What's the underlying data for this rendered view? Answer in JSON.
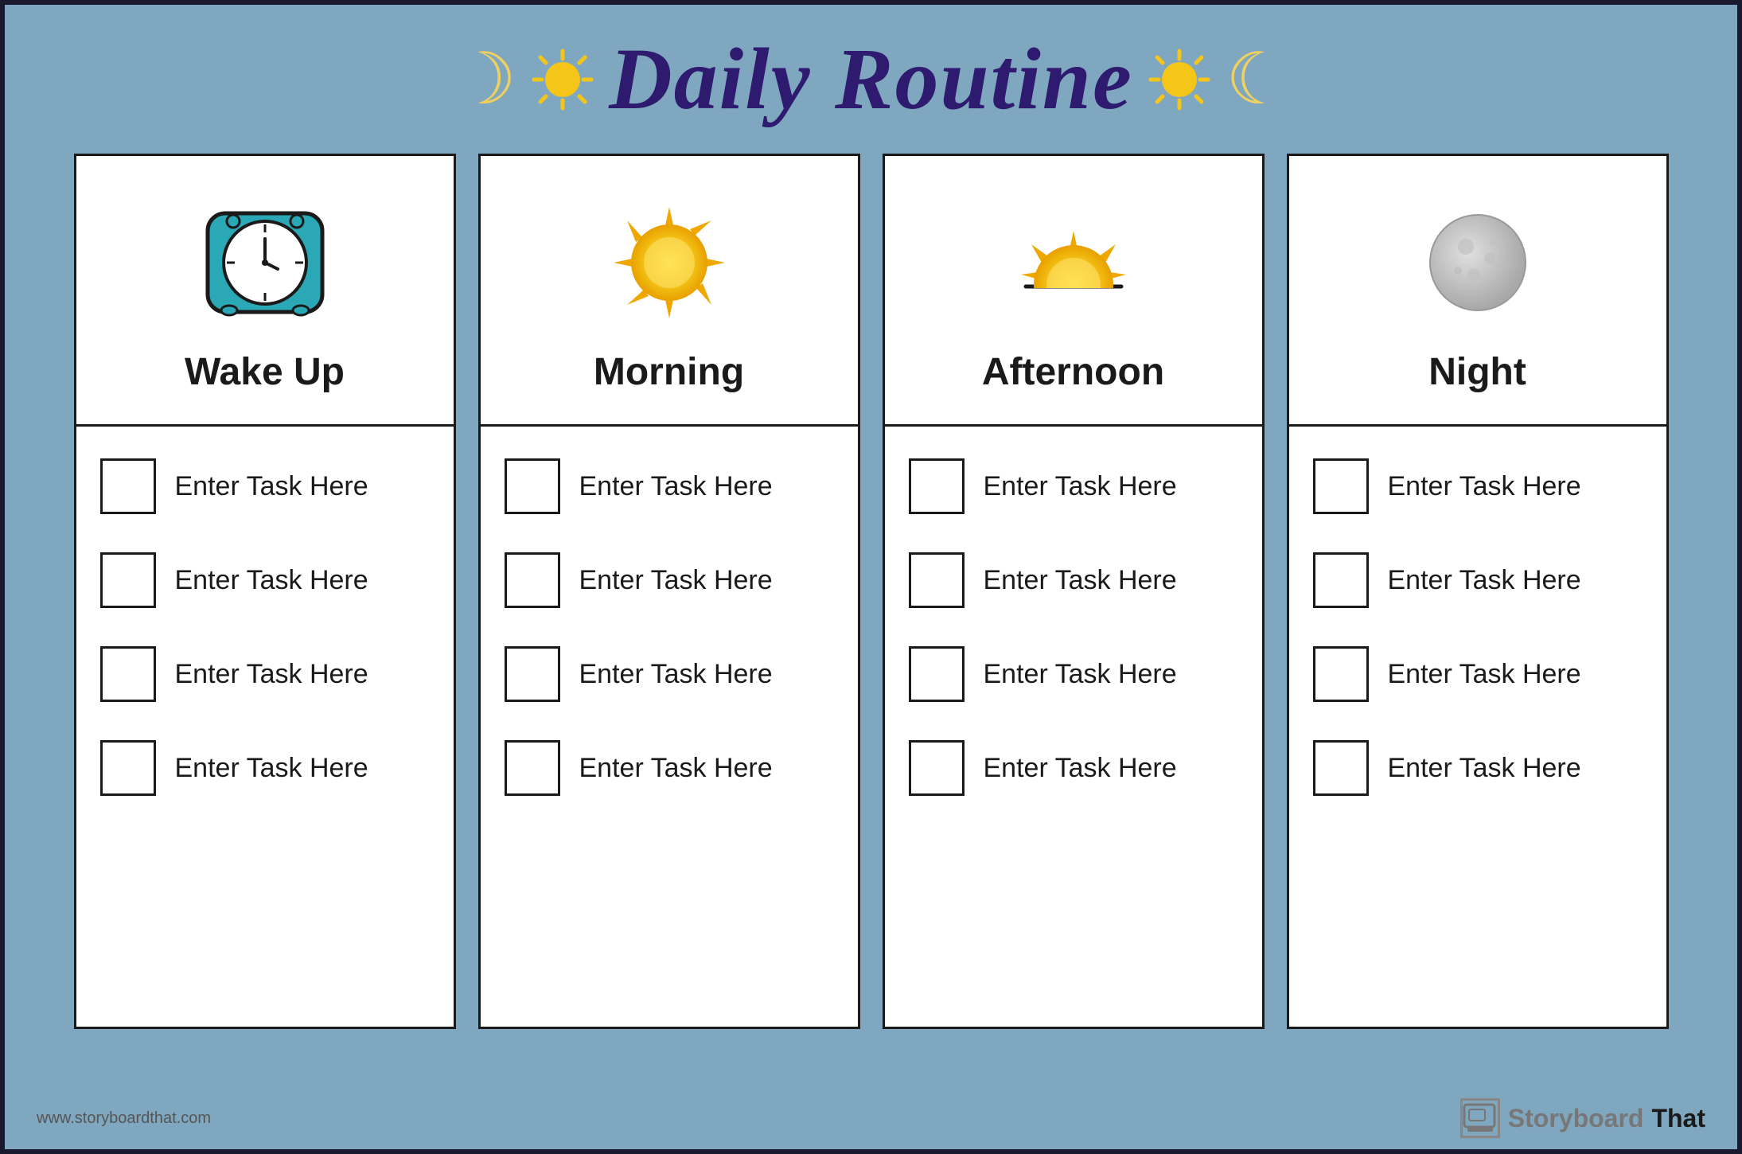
{
  "header": {
    "title": "Daily Routine",
    "moon_symbol": "☽",
    "sun_symbol": "✦"
  },
  "columns": [
    {
      "id": "wake-up",
      "label": "Wake Up",
      "icon_type": "clock",
      "tasks": [
        "Enter Task Here",
        "Enter Task Here",
        "Enter Task Here",
        "Enter Task Here"
      ]
    },
    {
      "id": "morning",
      "label": "Morning",
      "icon_type": "sun",
      "tasks": [
        "Enter Task Here",
        "Enter Task Here",
        "Enter Task Here",
        "Enter Task Here"
      ]
    },
    {
      "id": "afternoon",
      "label": "Afternoon",
      "icon_type": "afternoon",
      "tasks": [
        "Enter Task Here",
        "Enter Task Here",
        "Enter Task Here",
        "Enter Task Here"
      ]
    },
    {
      "id": "night",
      "label": "Night",
      "icon_type": "moon",
      "tasks": [
        "Enter Task Here",
        "Enter Task Here",
        "Enter Task Here",
        "Enter Task Here"
      ]
    }
  ],
  "footer": {
    "url": "www.storyboardthat.com",
    "logo_storyboard": "Storyboard",
    "logo_that": "That"
  }
}
